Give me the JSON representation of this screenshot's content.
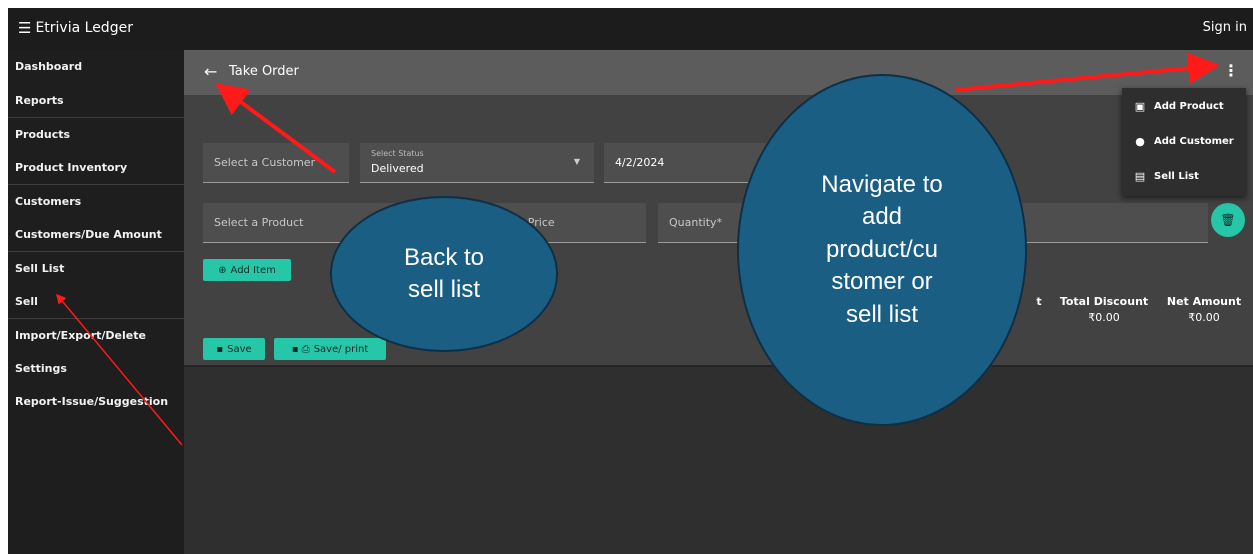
{
  "topbar": {
    "brand": "Etrivia Ledger",
    "signin": "Sign in"
  },
  "sidebar": {
    "items": [
      {
        "label": "Dashboard"
      },
      {
        "label": "Reports"
      },
      {
        "label": "Products"
      },
      {
        "label": "Product Inventory"
      },
      {
        "label": "Customers"
      },
      {
        "label": "Customers/Due Amount"
      },
      {
        "label": "Sell List"
      },
      {
        "label": "Sell"
      },
      {
        "label": "Import/Export/Delete"
      },
      {
        "label": "Settings"
      },
      {
        "label": "Report-Issue/Suggestion"
      }
    ]
  },
  "subbar": {
    "title": "Take Order",
    "back_icon": "arrow-left-icon",
    "more_icon": "more-vert-icon"
  },
  "form": {
    "customer_placeholder": "Select a Customer",
    "status_label": "Select Status",
    "status_value": "Delivered",
    "date_value": "4/2/2024",
    "product_placeholder": "Select a Product",
    "price_placeholder": "t Price",
    "quantity_placeholder": "Quantity*",
    "add_item": "Add Item",
    "save": "Save",
    "save_print": "Save/ print"
  },
  "totals": {
    "partial_label": "t",
    "total_discount_label": "Total Discount",
    "total_discount_value": "₹0.00",
    "net_amount_label": "Net Amount",
    "net_amount_value": "₹0.00"
  },
  "menu": {
    "items": [
      {
        "label": "Add Product",
        "icon": "archive-icon"
      },
      {
        "label": "Add Customer",
        "icon": "person-icon"
      },
      {
        "label": "Sell List",
        "icon": "list-icon"
      }
    ]
  },
  "annotations": {
    "back_bubble": "Back to sell list",
    "nav_bubble_lines": [
      "Navigate to",
      "add",
      "product/cu",
      "stomer or",
      "sell list"
    ]
  },
  "colors": {
    "accent": "#26c6a8",
    "bubble": "#1a5e84",
    "arrow": "#ff1a1a"
  }
}
